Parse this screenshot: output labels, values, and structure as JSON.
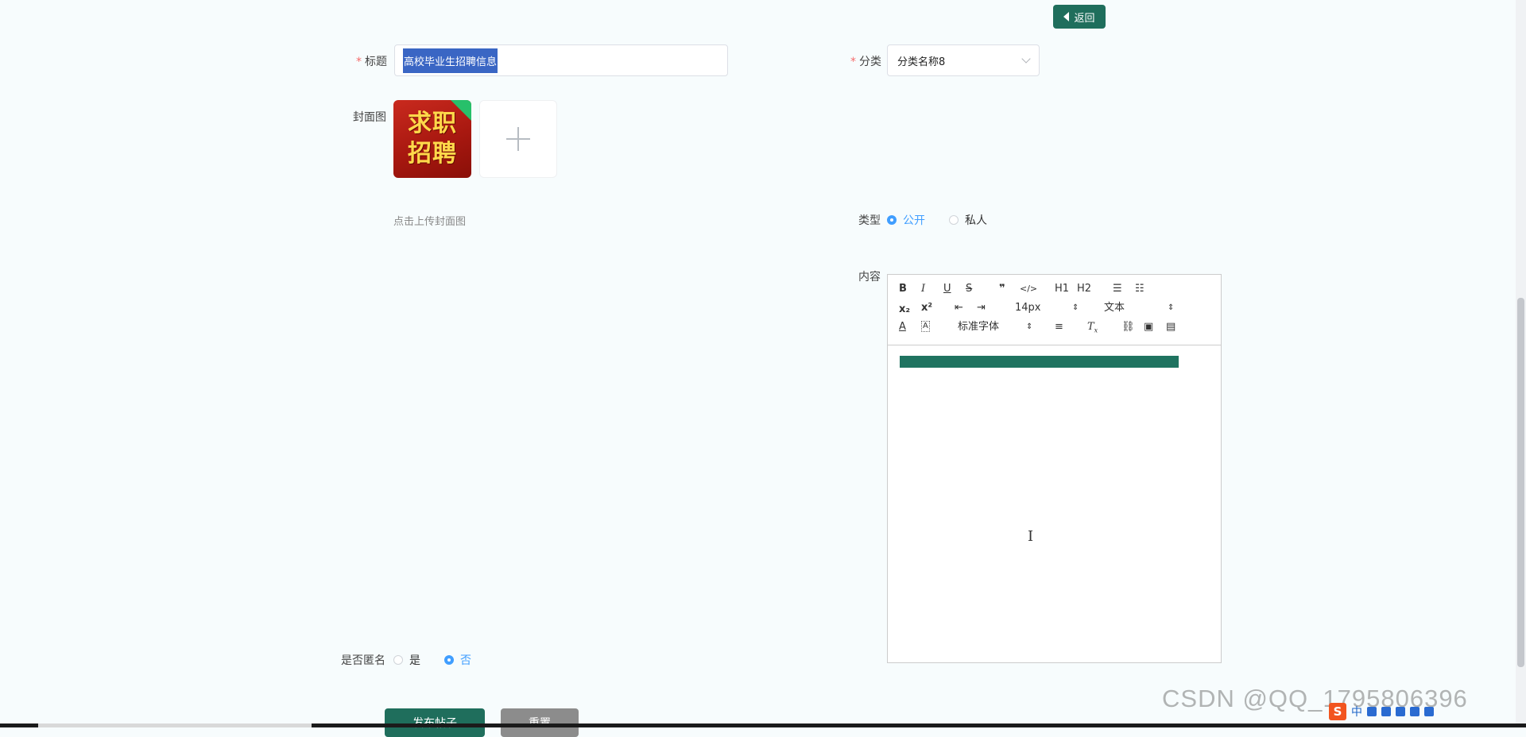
{
  "back_button": {
    "label": "返回"
  },
  "form": {
    "title": {
      "label": "标题",
      "value": "高校毕业生招聘信息",
      "required": true
    },
    "category": {
      "label": "分类",
      "value": "分类名称8",
      "required": true
    },
    "cover": {
      "label": "封面图",
      "image_lines": [
        "求职",
        "招聘"
      ],
      "hint": "点击上传封面图"
    },
    "type": {
      "label": "类型",
      "options": [
        "公开",
        "私人"
      ],
      "selected": "公开"
    },
    "content": {
      "label": "内容"
    },
    "anonymous": {
      "label": "是否匿名",
      "options": [
        "是",
        "否"
      ],
      "selected": "否"
    }
  },
  "editor_toolbar": {
    "row1": [
      "B",
      "I",
      "U",
      "S",
      "❞",
      "</>",
      "H1",
      "H2",
      "ordered-list-icon",
      "bullet-list-icon"
    ],
    "font_size": "14px",
    "header_select": "文本",
    "font_family": "标准字体"
  },
  "buttons": {
    "submit": "发布帖子",
    "reset": "重置"
  },
  "watermark": "CSDN @QQ_1795806396",
  "tray": {
    "ime": "中"
  },
  "colors": {
    "primary": "#1f6e5c",
    "accent": "#409eff",
    "required": "#f56c6c"
  }
}
